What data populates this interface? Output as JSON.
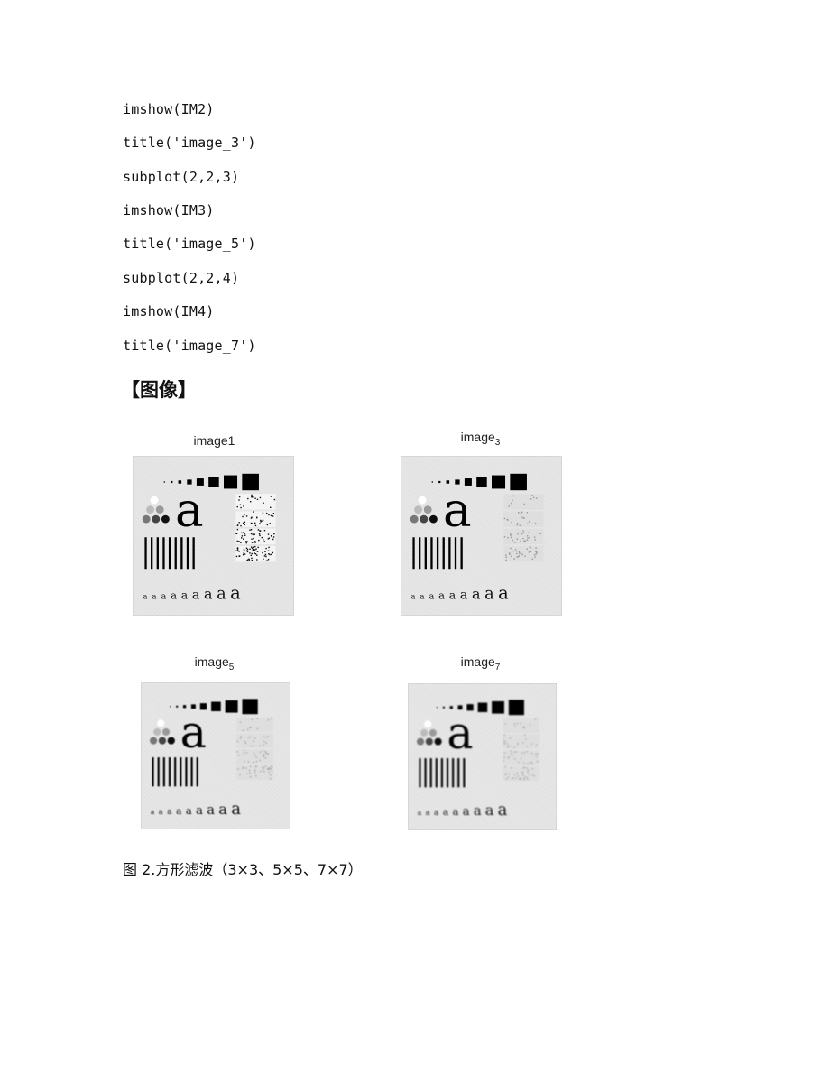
{
  "code_lines": [
    "imshow(IM2)",
    "title('image_3')",
    "subplot(2,2,3)",
    "imshow(IM3)",
    "title('image_5')",
    "subplot(2,2,4)",
    "imshow(IM4)",
    "title('image_7')"
  ],
  "section_heading": "【图像】",
  "figure": {
    "panels": [
      {
        "title_base": "image1",
        "title_sub": "",
        "variant": "original",
        "blur": 0
      },
      {
        "title_base": "image",
        "title_sub": "3",
        "variant": "filtered",
        "blur": 0.45
      },
      {
        "title_base": "image",
        "title_sub": "5",
        "variant": "filtered",
        "blur": 0.7
      },
      {
        "title_base": "image",
        "title_sub": "7",
        "variant": "filtered",
        "blur": 0.95
      }
    ],
    "test_pattern": {
      "big_letter": "a",
      "small_letter": "a",
      "bar_count": 9,
      "square_count": 8,
      "letter_count": 9
    }
  },
  "caption": "图 2.方形滤波（3×3、5×5、7×7）"
}
